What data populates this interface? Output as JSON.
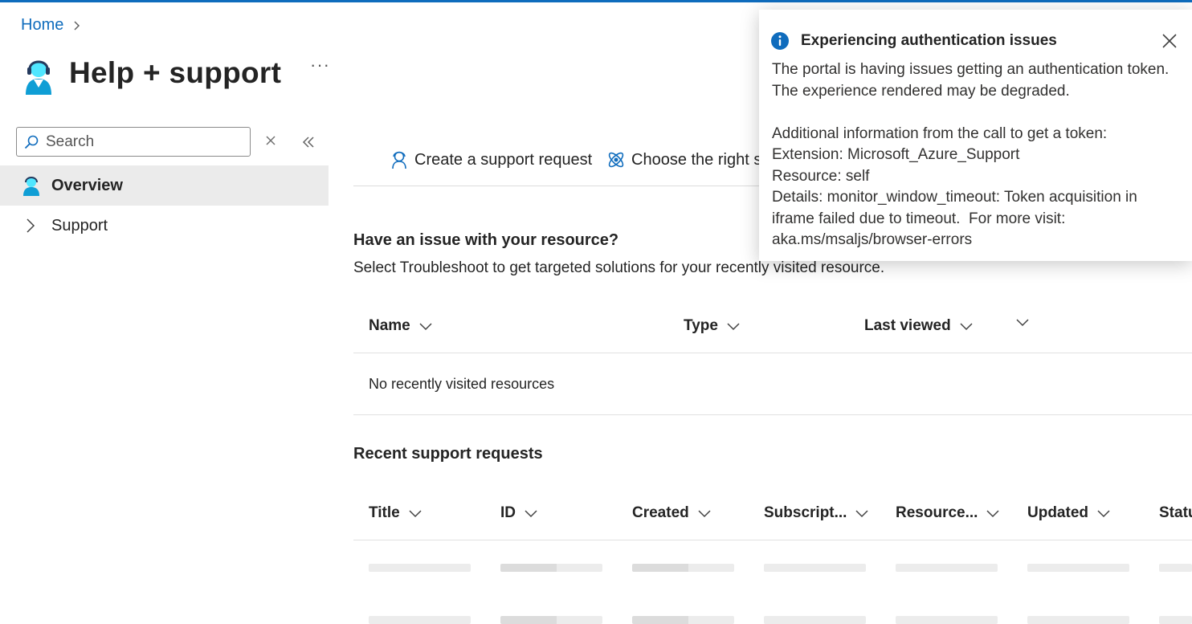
{
  "breadcrumb": {
    "home": "Home"
  },
  "page": {
    "title": "Help + support",
    "more": "···"
  },
  "sidebar": {
    "search_placeholder": "Search",
    "items": [
      {
        "label": "Overview",
        "icon": "support-agent-icon",
        "selected": true
      },
      {
        "label": "Support",
        "icon": "chevron-right-icon",
        "selected": false
      }
    ]
  },
  "toolbar": {
    "create_label": "Create a support request",
    "choose_label": "Choose the right s"
  },
  "resources": {
    "heading": "Have an issue with your resource?",
    "description": "Select Troubleshoot to get targeted solutions for your recently visited resource.",
    "columns": [
      "Name",
      "Type",
      "Last viewed"
    ],
    "empty_text": "No recently visited resources"
  },
  "requests": {
    "heading": "Recent support requests",
    "columns": [
      "Title",
      "ID",
      "Created",
      "Subscript...",
      "Resource...",
      "Updated",
      "Statu"
    ]
  },
  "toast": {
    "title": "Experiencing authentication issues",
    "message": "The portal is having issues getting an authentication token. The experience rendered may be degraded.",
    "details_intro": "Additional information from the call to get a token:",
    "extension": "Extension: Microsoft_Azure_Support",
    "resource": "Resource: self",
    "details": "Details: monitor_window_timeout: Token acquisition in iframe failed due to timeout.  For more visit: aka.ms/msaljs/browser-errors"
  },
  "colors": {
    "accent": "#0f6cbd",
    "info": "#0f6cbd",
    "selected_bg": "#ebebeb"
  }
}
